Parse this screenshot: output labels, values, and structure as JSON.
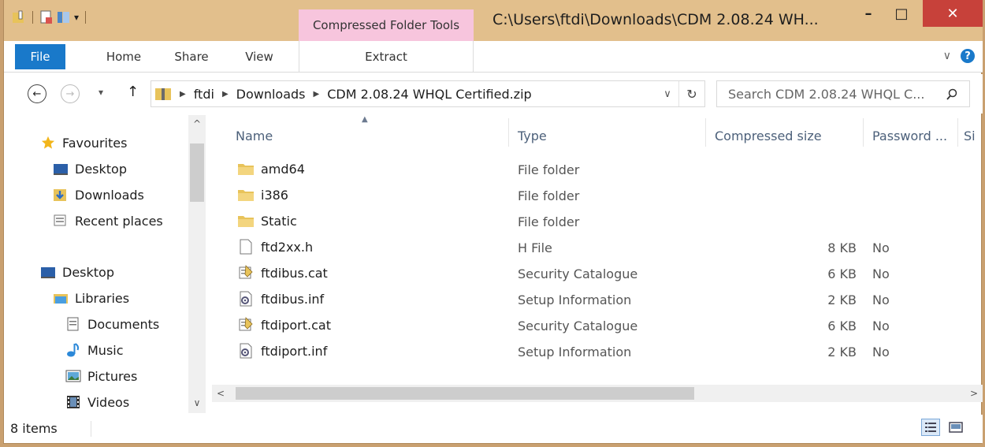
{
  "titlebar": {
    "context_tab": "Compressed Folder Tools",
    "title": "C:\\Users\\ftdi\\Downloads\\CDM 2.08.24 WH...",
    "minimize_glyph": "–",
    "maximize_glyph": "□",
    "close_glyph": "✕"
  },
  "ribbon": {
    "tabs": [
      "File",
      "Home",
      "Share",
      "View",
      "Extract"
    ],
    "expand_glyph": "∨",
    "help_glyph": "?"
  },
  "address": {
    "back_glyph": "←",
    "forward_glyph": "→",
    "recent_glyph": "▾",
    "up_glyph": "↑",
    "breadcrumbs": [
      "ftdi",
      "Downloads",
      "CDM 2.08.24 WHQL Certified.zip"
    ],
    "dropdown_glyph": "∨",
    "refresh_glyph": "↻",
    "search_placeholder": "Search CDM 2.08.24 WHQL C..."
  },
  "navpane": {
    "favourites": {
      "label": "Favourites",
      "items": [
        "Desktop",
        "Downloads",
        "Recent places"
      ]
    },
    "desktop": "Desktop",
    "libraries": {
      "label": "Libraries",
      "items": [
        "Documents",
        "Music",
        "Pictures",
        "Videos"
      ]
    }
  },
  "columns": [
    "Name",
    "Type",
    "Compressed size",
    "Password ...",
    "Si"
  ],
  "files": [
    {
      "name": "amd64",
      "type": "File folder",
      "size": "",
      "password": "",
      "icon": "folder-icon"
    },
    {
      "name": "i386",
      "type": "File folder",
      "size": "",
      "password": "",
      "icon": "folder-icon"
    },
    {
      "name": "Static",
      "type": "File folder",
      "size": "",
      "password": "",
      "icon": "folder-icon"
    },
    {
      "name": "ftd2xx.h",
      "type": "H File",
      "size": "8 KB",
      "password": "No",
      "icon": "file-icon"
    },
    {
      "name": "ftdibus.cat",
      "type": "Security Catalogue",
      "size": "6 KB",
      "password": "No",
      "icon": "catalogue-icon"
    },
    {
      "name": "ftdibus.inf",
      "type": "Setup Information",
      "size": "2 KB",
      "password": "No",
      "icon": "setup-info-icon"
    },
    {
      "name": "ftdiport.cat",
      "type": "Security Catalogue",
      "size": "6 KB",
      "password": "No",
      "icon": "catalogue-icon"
    },
    {
      "name": "ftdiport.inf",
      "type": "Setup Information",
      "size": "2 KB",
      "password": "No",
      "icon": "setup-info-icon"
    }
  ],
  "status": {
    "item_count": "8 items"
  },
  "colors": {
    "titlebar": "#e2bf8c",
    "context_tab": "#f7c5dd",
    "file_tab": "#1979ca",
    "close": "#c7413a",
    "folder": "#e8c35a"
  }
}
